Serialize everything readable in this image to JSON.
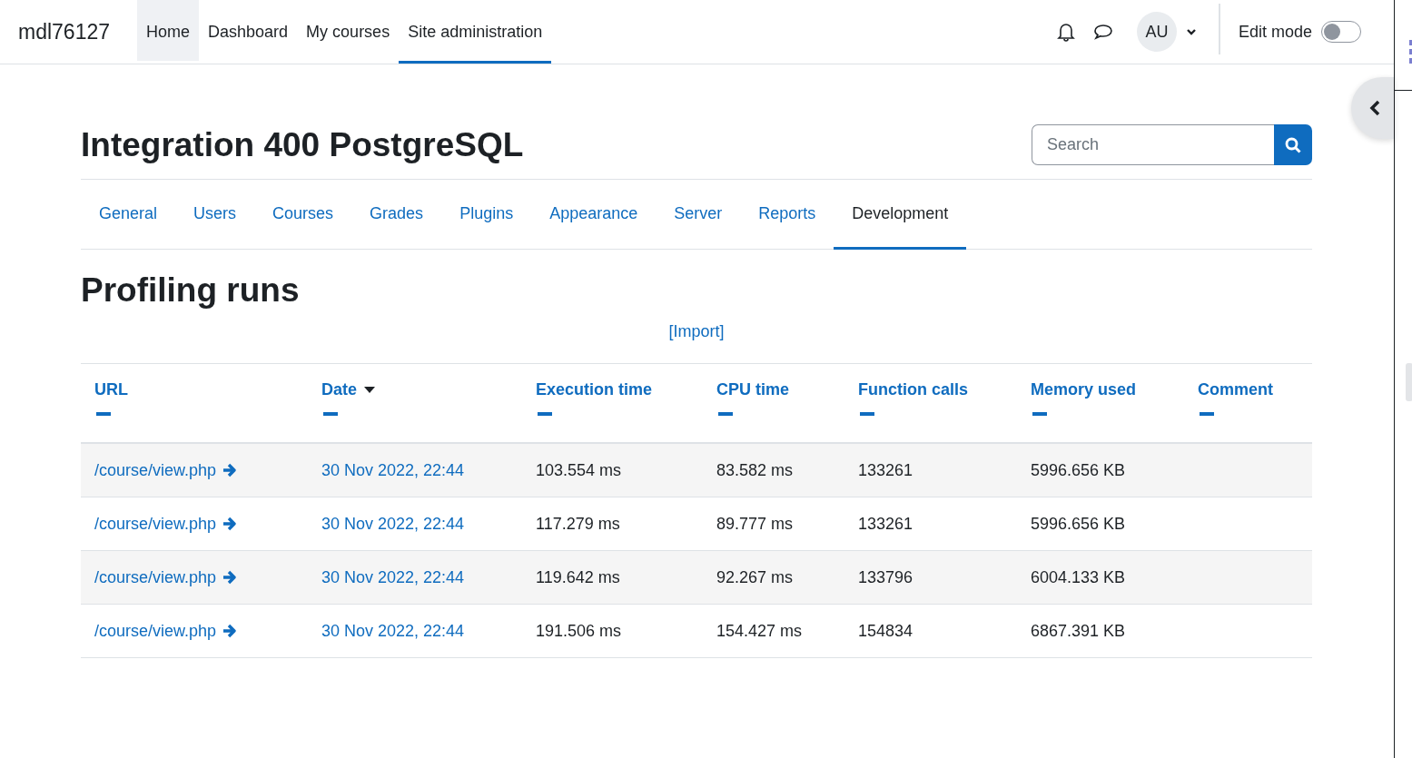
{
  "site_name": "mdl76127",
  "nav": [
    {
      "label": "Home",
      "selected": false,
      "hovered": true
    },
    {
      "label": "Dashboard",
      "selected": false,
      "hovered": false
    },
    {
      "label": "My courses",
      "selected": false,
      "hovered": false
    },
    {
      "label": "Site administration",
      "selected": true,
      "hovered": false
    }
  ],
  "user": {
    "initials": "AU"
  },
  "edit_mode": {
    "label": "Edit mode",
    "on": false
  },
  "page_title": "Integration 400 PostgreSQL",
  "search": {
    "placeholder": "Search"
  },
  "tabs": [
    {
      "label": "General",
      "selected": false
    },
    {
      "label": "Users",
      "selected": false
    },
    {
      "label": "Courses",
      "selected": false
    },
    {
      "label": "Grades",
      "selected": false
    },
    {
      "label": "Plugins",
      "selected": false
    },
    {
      "label": "Appearance",
      "selected": false
    },
    {
      "label": "Server",
      "selected": false
    },
    {
      "label": "Reports",
      "selected": false
    },
    {
      "label": "Development",
      "selected": true
    }
  ],
  "heading": "Profiling runs",
  "import_link": "[Import]",
  "table": {
    "columns": [
      {
        "label": "URL",
        "sorted": false
      },
      {
        "label": "Date",
        "sorted": true
      },
      {
        "label": "Execution time",
        "sorted": false
      },
      {
        "label": "CPU time",
        "sorted": false
      },
      {
        "label": "Function calls",
        "sorted": false
      },
      {
        "label": "Memory used",
        "sorted": false
      },
      {
        "label": "Comment",
        "sorted": false
      }
    ],
    "rows": [
      {
        "url": "/course/view.php",
        "date": "30 Nov 2022, 22:44",
        "exec": "103.554 ms",
        "cpu": "83.582 ms",
        "calls": "133261",
        "memory": "5996.656 KB"
      },
      {
        "url": "/course/view.php",
        "date": "30 Nov 2022, 22:44",
        "exec": "117.279 ms",
        "cpu": "89.777 ms",
        "calls": "133261",
        "memory": "5996.656 KB"
      },
      {
        "url": "/course/view.php",
        "date": "30 Nov 2022, 22:44",
        "exec": "119.642 ms",
        "cpu": "92.267 ms",
        "calls": "133796",
        "memory": "6004.133 KB"
      },
      {
        "url": "/course/view.php",
        "date": "30 Nov 2022, 22:44",
        "exec": "191.506 ms",
        "cpu": "154.427 ms",
        "calls": "154834",
        "memory": "6867.391 KB"
      }
    ]
  }
}
